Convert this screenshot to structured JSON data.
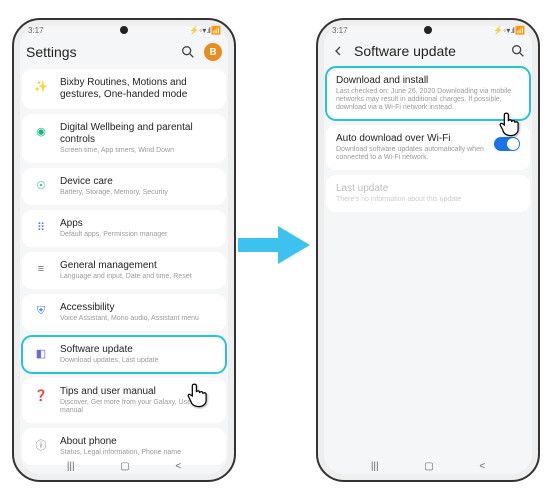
{
  "status": {
    "time": "3:17",
    "icons": "⚡ ◦ ▾ .ıl 📶"
  },
  "left": {
    "header": {
      "title": "Settings",
      "avatar": "B"
    },
    "items": [
      {
        "icon": "✨",
        "hue": "#f59e0b",
        "title": "Bixby Routines, Motions and gestures, One-handed mode",
        "sub": ""
      },
      {
        "icon": "◉",
        "hue": "#10b981",
        "title": "Digital Wellbeing and parental controls",
        "sub": "Screen time, App timers, Wind Down"
      },
      {
        "icon": "☉",
        "hue": "#10b981",
        "title": "Device care",
        "sub": "Battery, Storage, Memory, Security"
      },
      {
        "icon": "⠿",
        "hue": "#3b82f6",
        "title": "Apps",
        "sub": "Default apps, Permission manager"
      },
      {
        "icon": "≡",
        "hue": "#6b7280",
        "title": "General management",
        "sub": "Language and input, Date and time, Reset"
      },
      {
        "icon": "⛨",
        "hue": "#3b82f6",
        "title": "Accessibility",
        "sub": "Voice Assistant, Mono audio, Assistant menu"
      },
      {
        "icon": "◧",
        "hue": "#6366f1",
        "title": "Software update",
        "sub": "Download updates, Last update",
        "hl": true
      },
      {
        "icon": "❓",
        "hue": "#f59e0b",
        "title": "Tips and user manual",
        "sub": "Discover, Get more from your Galaxy, User manual"
      },
      {
        "icon": "ⓘ",
        "hue": "#6b7280",
        "title": "About phone",
        "sub": "Status, Legal information, Phone name"
      }
    ]
  },
  "right": {
    "header": {
      "title": "Software update"
    },
    "items": [
      {
        "title": "Download and install",
        "sub": "Last checked on: June 26, 2020\nDownloading via mobile networks may result in additional charges. If possible, download via a Wi-Fi network instead.",
        "hl": true
      },
      {
        "title": "Auto download over Wi-Fi",
        "sub": "Download software updates automatically when connected to a Wi-Fi network.",
        "toggle": true
      },
      {
        "title": "Last update",
        "sub": "There's no information about this update",
        "dim": true
      }
    ]
  },
  "nav": {
    "recent": "|||",
    "home": "▢",
    "back": "<"
  }
}
